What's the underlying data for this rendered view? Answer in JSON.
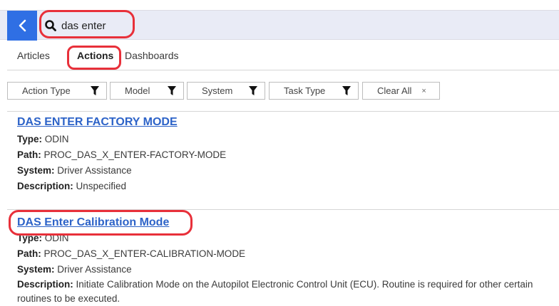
{
  "search": {
    "value": "das enter"
  },
  "tabs": [
    {
      "label": "Articles"
    },
    {
      "label": "Actions"
    },
    {
      "label": "Dashboards"
    }
  ],
  "filters": [
    {
      "label": "Action Type"
    },
    {
      "label": "Model"
    },
    {
      "label": "System"
    },
    {
      "label": "Task Type"
    }
  ],
  "clear_all": {
    "label": "Clear All",
    "close": "×"
  },
  "field_labels": {
    "type": "Type:",
    "path": "Path:",
    "system": "System:",
    "description": "Description:"
  },
  "results": [
    {
      "title": "DAS ENTER FACTORY MODE",
      "type": "ODIN",
      "path": "PROC_DAS_X_ENTER-FACTORY-MODE",
      "system": "Driver Assistance",
      "description": "Unspecified"
    },
    {
      "title": "DAS Enter Calibration Mode",
      "type": "ODIN",
      "path": "PROC_DAS_X_ENTER-CALIBRATION-MODE",
      "system": "Driver Assistance",
      "description": "Initiate Calibration Mode on the Autopilot Electronic Control Unit (ECU). Routine is required for other certain routines to be executed."
    }
  ],
  "colors": {
    "accent": "#2f6fe4",
    "link": "#2d63c8",
    "highlight": "#e8303a",
    "search_bar_bg": "#e9ebf6"
  }
}
